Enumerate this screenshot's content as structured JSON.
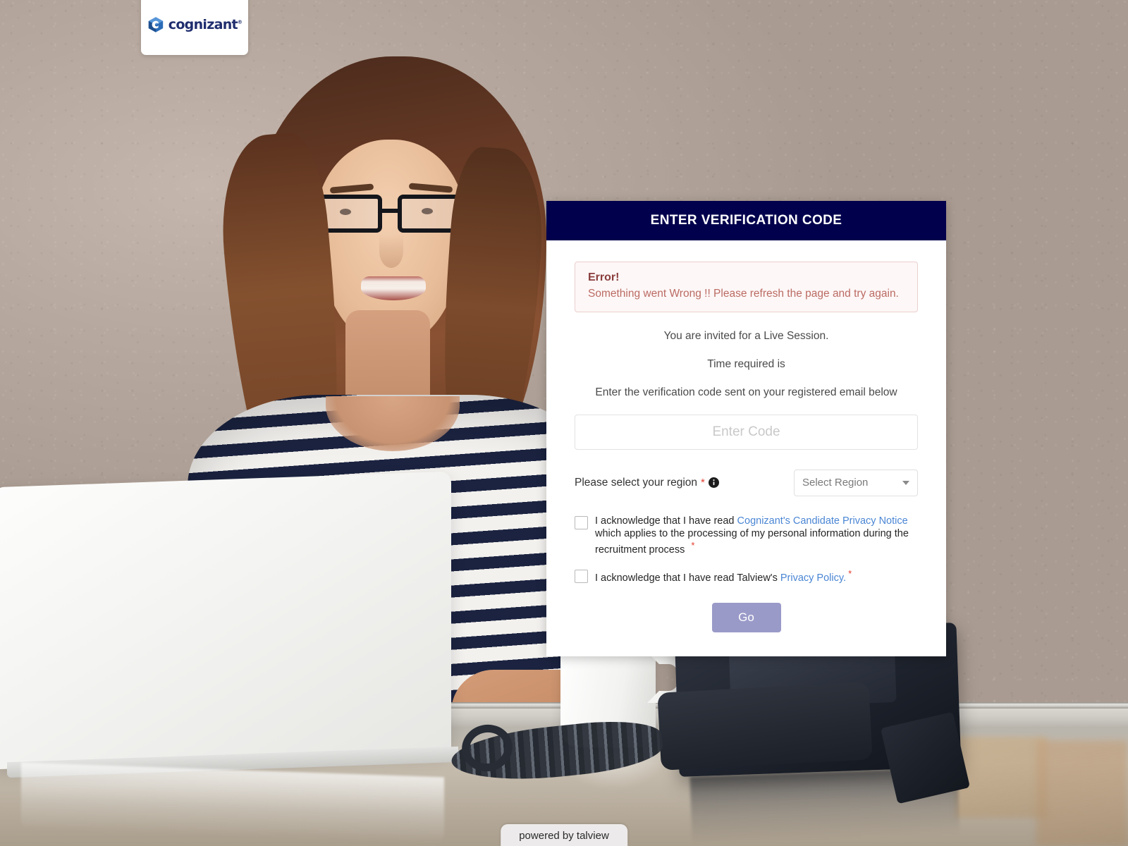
{
  "brand": {
    "logo_text": "cognizant",
    "logo_trademark": "®",
    "logo_icon": "cognizant-hexagon-icon"
  },
  "card": {
    "header_title": "ENTER VERIFICATION CODE",
    "header_color": "#00004d"
  },
  "error": {
    "title": "Error!",
    "message": "Something went Wrong !! Please refresh the page and try again.",
    "background": "#fdf7f7",
    "border_color": "#eccfcf",
    "title_color": "#8a3d3d",
    "text_color": "#bb6b63"
  },
  "info": {
    "line1": "You are invited for a Live Session.",
    "line2": "Time required is",
    "line3": "Enter the verification code sent on your registered email below"
  },
  "code_field": {
    "value": "",
    "placeholder": "Enter Code"
  },
  "region": {
    "label": "Please select your region",
    "required_marker": "*",
    "info_icon": "info-circle-icon",
    "select_value": "Select Region",
    "caret_icon": "chevron-down-icon"
  },
  "consents": [
    {
      "checked": false,
      "prefix": "I acknowledge that I have read ",
      "link": "Cognizant's Candidate Privacy Notice",
      "suffix": " which applies to the processing of my personal information during the recruitment process",
      "required_marker": "*"
    },
    {
      "checked": false,
      "prefix": "I acknowledge that I have read Talview's ",
      "link": "Privacy Policy.",
      "suffix": "",
      "required_marker": "*"
    }
  ],
  "submit": {
    "label": "Go",
    "color": "#9a9ac9",
    "enabled": false
  },
  "footer": {
    "powered_by": "powered by talview"
  },
  "link_color": "#4a86d4",
  "required_color": "#e23c2e"
}
